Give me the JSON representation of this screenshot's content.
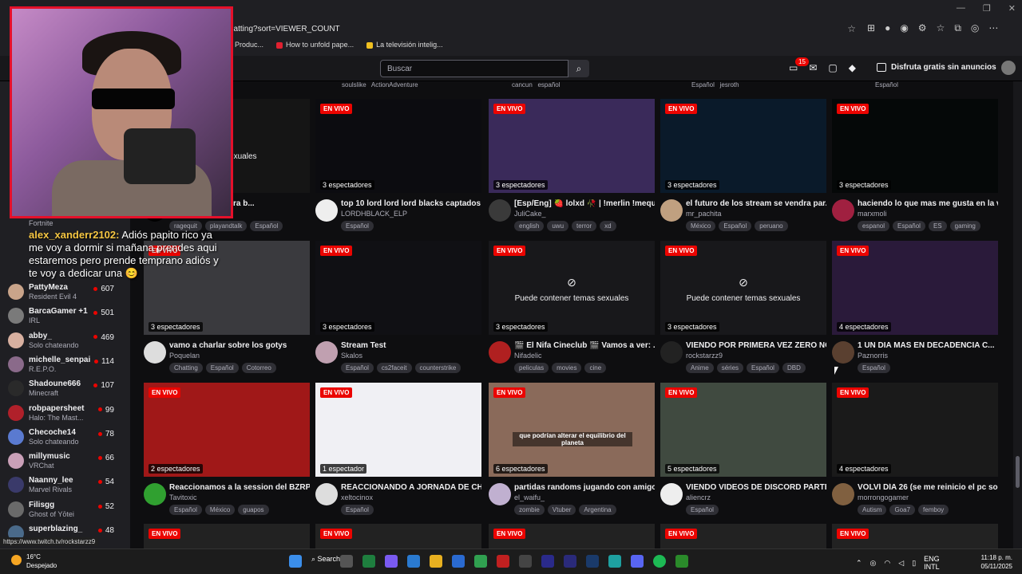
{
  "browser": {
    "url": "chatting?sort=VIEWER_COUNT",
    "bookmarks": [
      "Produc...",
      "How to unfold pape...",
      "La televisión intelig..."
    ],
    "window_controls": [
      "—",
      "❐",
      "✕"
    ]
  },
  "topbar": {
    "search_placeholder": "Buscar",
    "notification_count": "15",
    "prime_label": "Disfruta gratis sin anuncios"
  },
  "sidebar": {
    "top_game": "Fortnite",
    "items": [
      {
        "name": "PattyMeza",
        "game": "Resident Evil 4",
        "count": "607",
        "color": "#c9a48a"
      },
      {
        "name": "BarcaGamer +1",
        "game": "IRL",
        "count": "501",
        "color": "#7a7a7a"
      },
      {
        "name": "abby_",
        "game": "Solo chateando",
        "count": "469",
        "color": "#d8b0a0"
      },
      {
        "name": "michelle_senpai",
        "game": "R.E.P.O.",
        "count": "114",
        "color": "#8a6a8a"
      },
      {
        "name": "Shadoune666",
        "game": "Minecraft",
        "count": "107",
        "color": "#2a2a2a"
      },
      {
        "name": "robpapersheet",
        "game": "Halo: The Mast...",
        "count": "99",
        "color": "#b0202a"
      },
      {
        "name": "Checoche14",
        "game": "Solo chateando",
        "count": "78",
        "color": "#5a7ad0"
      },
      {
        "name": "millymusic",
        "game": "VRChat",
        "count": "66",
        "color": "#caa0b8"
      },
      {
        "name": "Naanny_lee",
        "game": "Marvel Rivals",
        "count": "54",
        "color": "#3a3a6a"
      },
      {
        "name": "Filisgg",
        "game": "Ghost of Yōtei",
        "count": "52",
        "color": "#6a6a6a"
      },
      {
        "name": "superblazing_",
        "game": "",
        "count": "48",
        "color": "#4a6a8a"
      }
    ]
  },
  "chat_overlay": {
    "user": "alex_xanderr2102:",
    "text": " Adiós papito rico ya me voy a dormir si mañana prendes aqui estaremos pero prende temprano adiós y te voy a dedicar una 😊"
  },
  "top_tags": [
    {
      "left": "soulslike",
      "right": "ActionAdventure"
    },
    {
      "left": "cancun",
      "right": "español"
    },
    {
      "left": "Español",
      "right": "jesroth"
    },
    {
      "left": "Español",
      "right": ""
    }
  ],
  "row1": [
    {
      "thumb_color": "#151515",
      "viewers": "",
      "mature": "...emas sexuales",
      "title": "ONLINE - !bot para b...",
      "name": "",
      "tags": [
        "ragequit",
        "playandtalk",
        "Español"
      ],
      "avatar": "#000"
    },
    {
      "thumb_color": "#0c0c10",
      "viewers": "3 espectadores",
      "mature": "",
      "title": "top 10 lord lord lord blacks captados ...",
      "name": "LORDHBLACK_ELP",
      "tags": [
        "Español"
      ],
      "avatar": "#eee"
    },
    {
      "thumb_color": "#3a2a5a",
      "viewers": "3 espectadores",
      "mature": "",
      "title": "[Esp/Eng] 🍓 lolxd 🥀 | !merlin !mequ...",
      "name": "JuliCake_",
      "tags": [
        "english",
        "uwu",
        "terror",
        "xd"
      ],
      "avatar": "#3a3a3a"
    },
    {
      "thumb_color": "#0a1a2a",
      "viewers": "3 espectadores",
      "mature": "",
      "title": "el futuro de los stream se vendra par...",
      "name": "mr_pachita",
      "tags": [
        "México",
        "Español",
        "peruano"
      ],
      "avatar": "#c0a080"
    },
    {
      "thumb_color": "#050808",
      "viewers": "3 espectadores",
      "mature": "",
      "title": "haciendo lo que mas me gusta en la v...",
      "name": "marxmoli",
      "tags": [
        "espanol",
        "Español",
        "ES",
        "gaming"
      ],
      "avatar": "#a02040"
    }
  ],
  "row2": [
    {
      "thumb_color": "#3a3a3e",
      "viewers": "3 espectadores",
      "mature": "",
      "title": "vamo a charlar sobre los gotys",
      "name": "Poquelan",
      "tags": [
        "Chatting",
        "Español",
        "Cotorreo"
      ],
      "avatar": "#ddd"
    },
    {
      "thumb_color": "#101014",
      "viewers": "3 espectadores",
      "mature": "",
      "title": "Stream Test",
      "name": "Skalos",
      "tags": [
        "Español",
        "cs2faceit",
        "counterstrike"
      ],
      "avatar": "#c0a0b0"
    },
    {
      "thumb_color": "#18181b",
      "viewers": "3 espectadores",
      "mature": "Puede contener temas sexuales",
      "title": "🎬 El Nifa Cineclub 🎬 Vamos a ver: ...",
      "name": "Nifadelic",
      "tags": [
        "peliculas",
        "movies",
        "cine"
      ],
      "avatar": "#b02020"
    },
    {
      "thumb_color": "#18181b",
      "viewers": "3 espectadores",
      "mature": "Puede contener temas sexuales",
      "title": "VIENDO POR PRIMERA VEZ ZERO NO ...",
      "name": "rockstarzz9",
      "tags": [
        "Anime",
        "séries",
        "Español",
        "DBD"
      ],
      "avatar": "#222"
    },
    {
      "thumb_color": "#2a1a3a",
      "viewers": "4 espectadores",
      "mature": "",
      "title": "1 UN DIA MAS EN DECADENCIA C...",
      "name": "Paznorris",
      "tags": [
        "Español"
      ],
      "avatar": "#5a4030"
    }
  ],
  "row3": [
    {
      "thumb_color": "#a01818",
      "viewers": "2 espectadores",
      "mature": "",
      "title": "Reaccionamos a la session del BZRP ...",
      "name": "Tavitoxic",
      "tags": [
        "Español",
        "México",
        "guapos"
      ],
      "avatar": "#30a030"
    },
    {
      "thumb_color": "#f0f0f4",
      "viewers": "1 espectador",
      "mature": "",
      "title": "REACCIONANDO A JORNADA DE CH...",
      "name": "xeltocinox",
      "tags": [
        "Español"
      ],
      "avatar": "#ddd"
    },
    {
      "thumb_color": "#8a6a5a",
      "viewers": "6 espectadores",
      "mature": "",
      "title": "partidas randoms jugando con amigo...",
      "name": "el_waifu_",
      "tags": [
        "zombie",
        "Vtuber",
        "Argentina"
      ],
      "avatar": "#c0b0d0"
    },
    {
      "thumb_color": "#404a40",
      "viewers": "5 espectadores",
      "mature": "",
      "title": "VIENDO VIDEOS DE DISCORD PARTE 2",
      "name": "aliencrz",
      "tags": [
        "Español"
      ],
      "avatar": "#eee"
    },
    {
      "thumb_color": "#1a1a1a",
      "viewers": "4 espectadores",
      "mature": "",
      "title": "VOLVÍ DÍA 26 (se me reinicio el pc sol...",
      "name": "morrongogamer",
      "tags": [
        "Autism",
        "Goa7",
        "femboy"
      ],
      "avatar": "#806040"
    }
  ],
  "live_label": "EN VIVO",
  "sea_caption": "que podrían alterar el equilibrio del planeta",
  "status_url": "https://www.twitch.tv/rockstarzz9",
  "taskbar": {
    "temp": "16°C",
    "weather": "Despejado",
    "search": "Search",
    "lang1": "ENG",
    "lang2": "INTL",
    "time": "11:18 p. m.",
    "date": "05/11/2025"
  }
}
